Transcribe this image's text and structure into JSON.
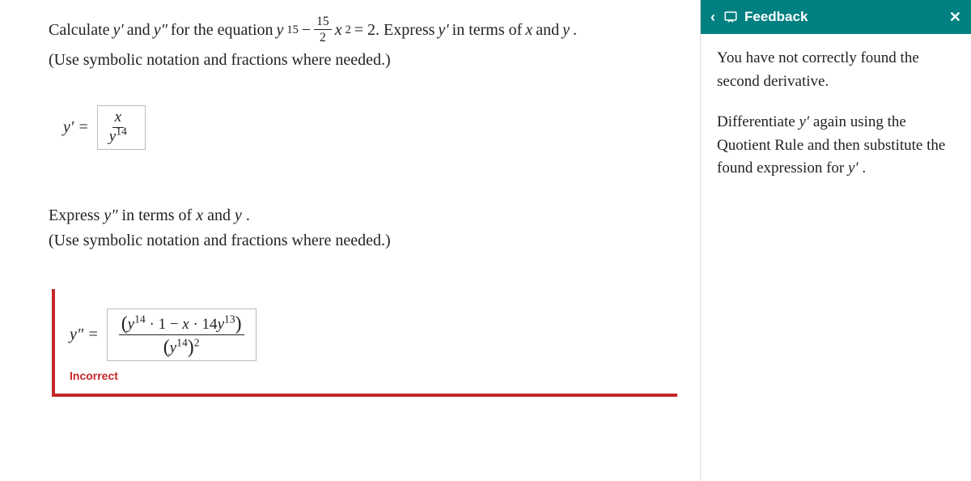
{
  "question": {
    "prompt_pre": "Calculate ",
    "yprime": "y′",
    "and": " and ",
    "ydprime": "y″",
    "for_eq": " for the equation ",
    "eq_lhs_base": "y",
    "eq_lhs_exp": "15",
    "minus": " − ",
    "frac_num": "15",
    "frac_den": "2",
    "x": "x",
    "x_exp": "2",
    "eq_rhs": " = 2. Express ",
    "in_terms": " in terms of ",
    "xvar": "x",
    "and2": " and ",
    "yvar": "y",
    "period": ".",
    "hint": "(Use symbolic notation and fractions where needed.)"
  },
  "answer1": {
    "label_var": "y′",
    "label_eq": " = ",
    "value_num": "x",
    "value_den_base": "y",
    "value_den_exp": "14"
  },
  "section2": {
    "line1_pre": "Express ",
    "line1_var": "y″",
    "line1_post": " in terms of ",
    "line1_x": "x",
    "line1_and": " and ",
    "line1_y": "y",
    "line1_period": ".",
    "hint": "(Use symbolic notation and fractions where needed.)"
  },
  "answer2": {
    "label_var": "y″",
    "label_eq": " = ",
    "num_y": "y",
    "num_exp1": "14",
    "num_dot1": " · 1 − ",
    "num_x": "x",
    "num_dot2": " · 14",
    "num_y2": "y",
    "num_exp2": "13",
    "den_y": "y",
    "den_exp": "14",
    "den_outer_exp": "2",
    "incorrect": "Incorrect"
  },
  "feedback": {
    "title": "Feedback",
    "prev": "‹",
    "close": "✕",
    "p1": "You have not correctly found the second derivative.",
    "p2_a": "Differentiate ",
    "p2_var1": "y′",
    "p2_b": " again using the Quotient Rule and then substitute the found expression for ",
    "p2_var2": "y′",
    "p2_c": "."
  }
}
